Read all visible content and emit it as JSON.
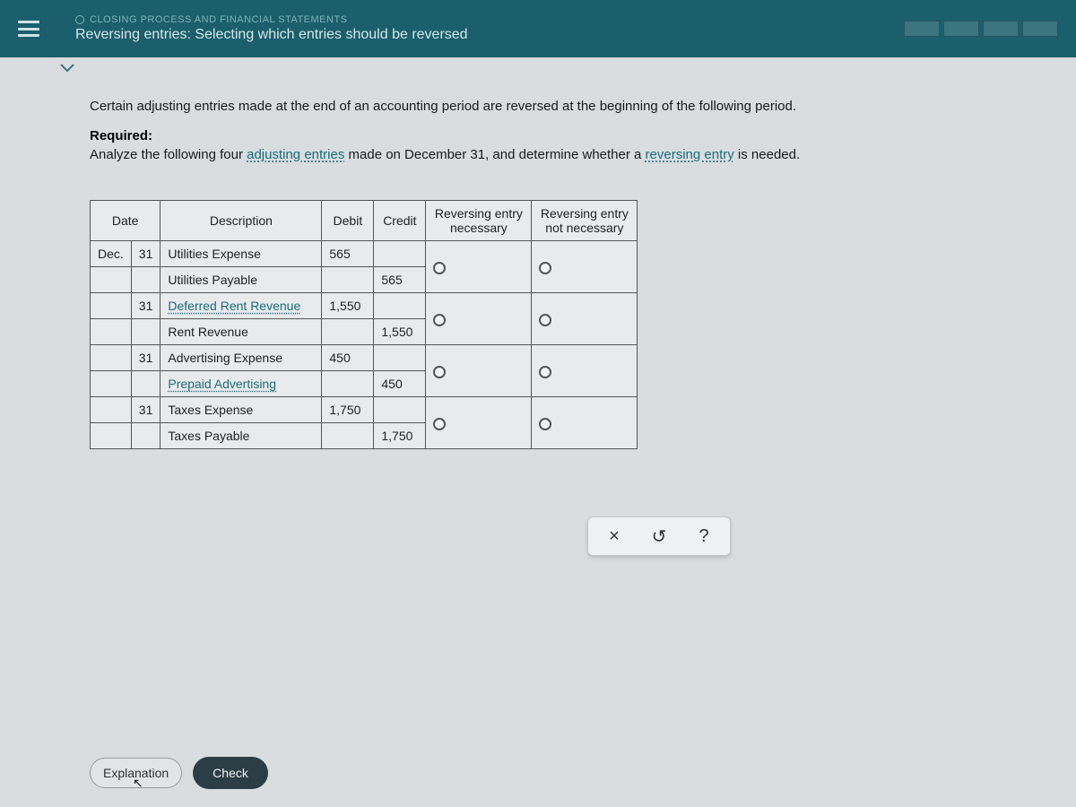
{
  "header": {
    "topic": "CLOSING PROCESS AND FINANCIAL STATEMENTS",
    "title": "Reversing entries: Selecting which entries should be reversed"
  },
  "body": {
    "intro": "Certain adjusting entries made at the end of an accounting period are reversed at the beginning of the following period.",
    "required_label": "Required:",
    "required_text_a": "Analyze the following four ",
    "term1": "adjusting entries",
    "required_text_b": " made on December 31, and determine whether a ",
    "term2": "reversing entry",
    "required_text_c": " is needed."
  },
  "table": {
    "headers": {
      "date": "Date",
      "description": "Description",
      "debit": "Debit",
      "credit": "Credit",
      "rev_nec": "Reversing entry necessary",
      "rev_not": "Reversing entry not necessary"
    },
    "month": "Dec.",
    "entries": [
      {
        "day": "31",
        "account": "Utilities Expense",
        "sub": "Utilities Payable",
        "debit": "565",
        "credit": "565",
        "term_sub": false,
        "term_acc": false
      },
      {
        "day": "31",
        "account": "Deferred Rent Revenue",
        "sub": "Rent Revenue",
        "debit": "1,550",
        "credit": "1,550",
        "term_sub": false,
        "term_acc": true
      },
      {
        "day": "31",
        "account": "Advertising Expense",
        "sub": "Prepaid Advertising",
        "debit": "450",
        "credit": "450",
        "term_sub": true,
        "term_acc": false
      },
      {
        "day": "31",
        "account": "Taxes Expense",
        "sub": "Taxes Payable",
        "debit": "1,750",
        "credit": "1,750",
        "term_sub": false,
        "term_acc": false
      }
    ]
  },
  "toolbar": {
    "clear": "×",
    "undo": "↺",
    "help": "?"
  },
  "footer": {
    "explanation": "Explanation",
    "check": "Check"
  }
}
